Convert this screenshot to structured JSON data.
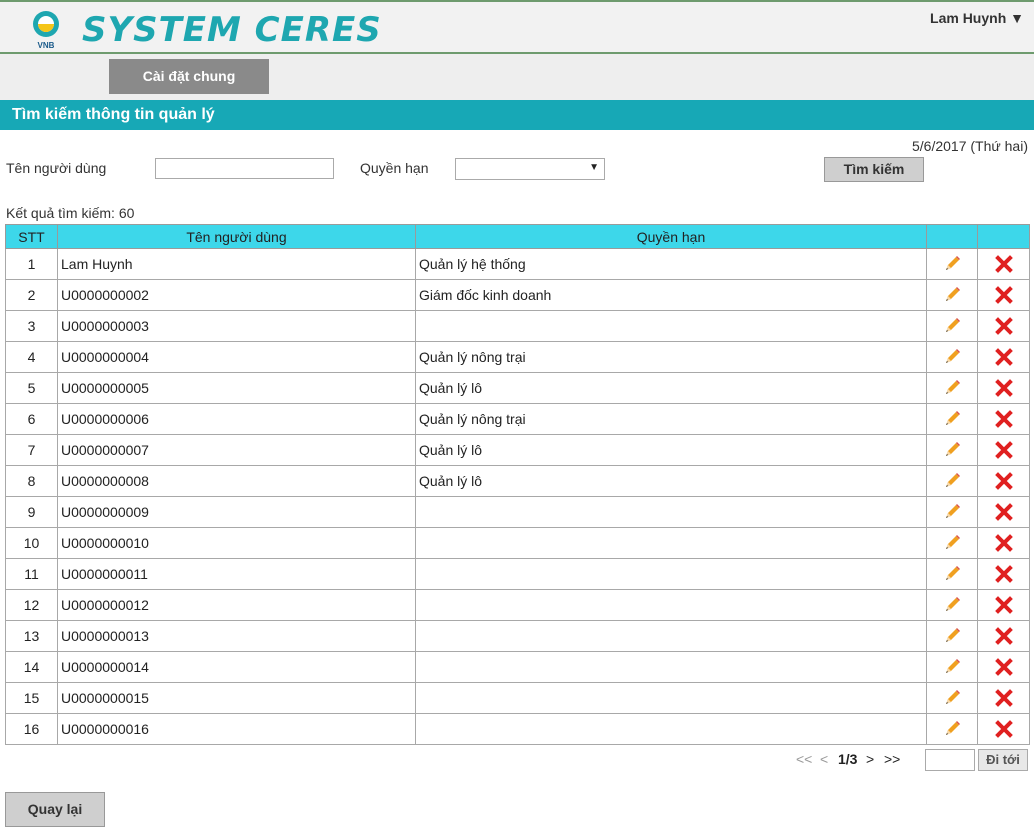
{
  "header": {
    "logo_text": "VNB",
    "app_title": "SYSTEM CERES",
    "user_menu": "Lam Huynh ▼"
  },
  "nav": {
    "general_settings": "Cài đặt chung"
  },
  "section": {
    "title": "Tìm kiếm thông tin quản lý"
  },
  "date": "5/6/2017 (Thứ hai)",
  "search": {
    "username_label": "Tên người dùng",
    "username_value": "",
    "role_label": "Quyền hạn",
    "role_selected": "",
    "search_button": "Tìm kiếm"
  },
  "results": {
    "count_text": "Kết quả tìm kiếm: 60",
    "columns": [
      "STT",
      "Tên người dùng",
      "Quyền hạn",
      "",
      ""
    ],
    "rows": [
      {
        "stt": "1",
        "name": "Lam Huynh",
        "role": "Quản lý hệ thống"
      },
      {
        "stt": "2",
        "name": "U0000000002",
        "role": "Giám đốc kinh doanh"
      },
      {
        "stt": "3",
        "name": "U0000000003",
        "role": ""
      },
      {
        "stt": "4",
        "name": "U0000000004",
        "role": "Quản lý nông trại"
      },
      {
        "stt": "5",
        "name": "U0000000005",
        "role": "Quản lý lô"
      },
      {
        "stt": "6",
        "name": "U0000000006",
        "role": "Quản lý nông trại"
      },
      {
        "stt": "7",
        "name": "U0000000007",
        "role": "Quản lý lô"
      },
      {
        "stt": "8",
        "name": "U0000000008",
        "role": "Quản lý lô"
      },
      {
        "stt": "9",
        "name": "U0000000009",
        "role": ""
      },
      {
        "stt": "10",
        "name": "U0000000010",
        "role": ""
      },
      {
        "stt": "11",
        "name": "U0000000011",
        "role": ""
      },
      {
        "stt": "12",
        "name": "U0000000012",
        "role": ""
      },
      {
        "stt": "13",
        "name": "U0000000013",
        "role": ""
      },
      {
        "stt": "14",
        "name": "U0000000014",
        "role": ""
      },
      {
        "stt": "15",
        "name": "U0000000015",
        "role": ""
      },
      {
        "stt": "16",
        "name": "U0000000016",
        "role": ""
      }
    ],
    "edit_icon": "pencil-icon",
    "delete_icon": "red-x-icon"
  },
  "pagination": {
    "first": "<<",
    "prev": "<",
    "page_info": "1/3",
    "next": ">",
    "last": ">>",
    "goto_value": "",
    "goto_button": "Đi tới"
  },
  "footer": {
    "back_button": "Quay lại"
  },
  "colors": {
    "brand": "#1ea7b0",
    "section_bar": "#17a8b6",
    "table_header": "#3dd7ea",
    "delete": "#e02020",
    "edit": "#f0a020"
  }
}
